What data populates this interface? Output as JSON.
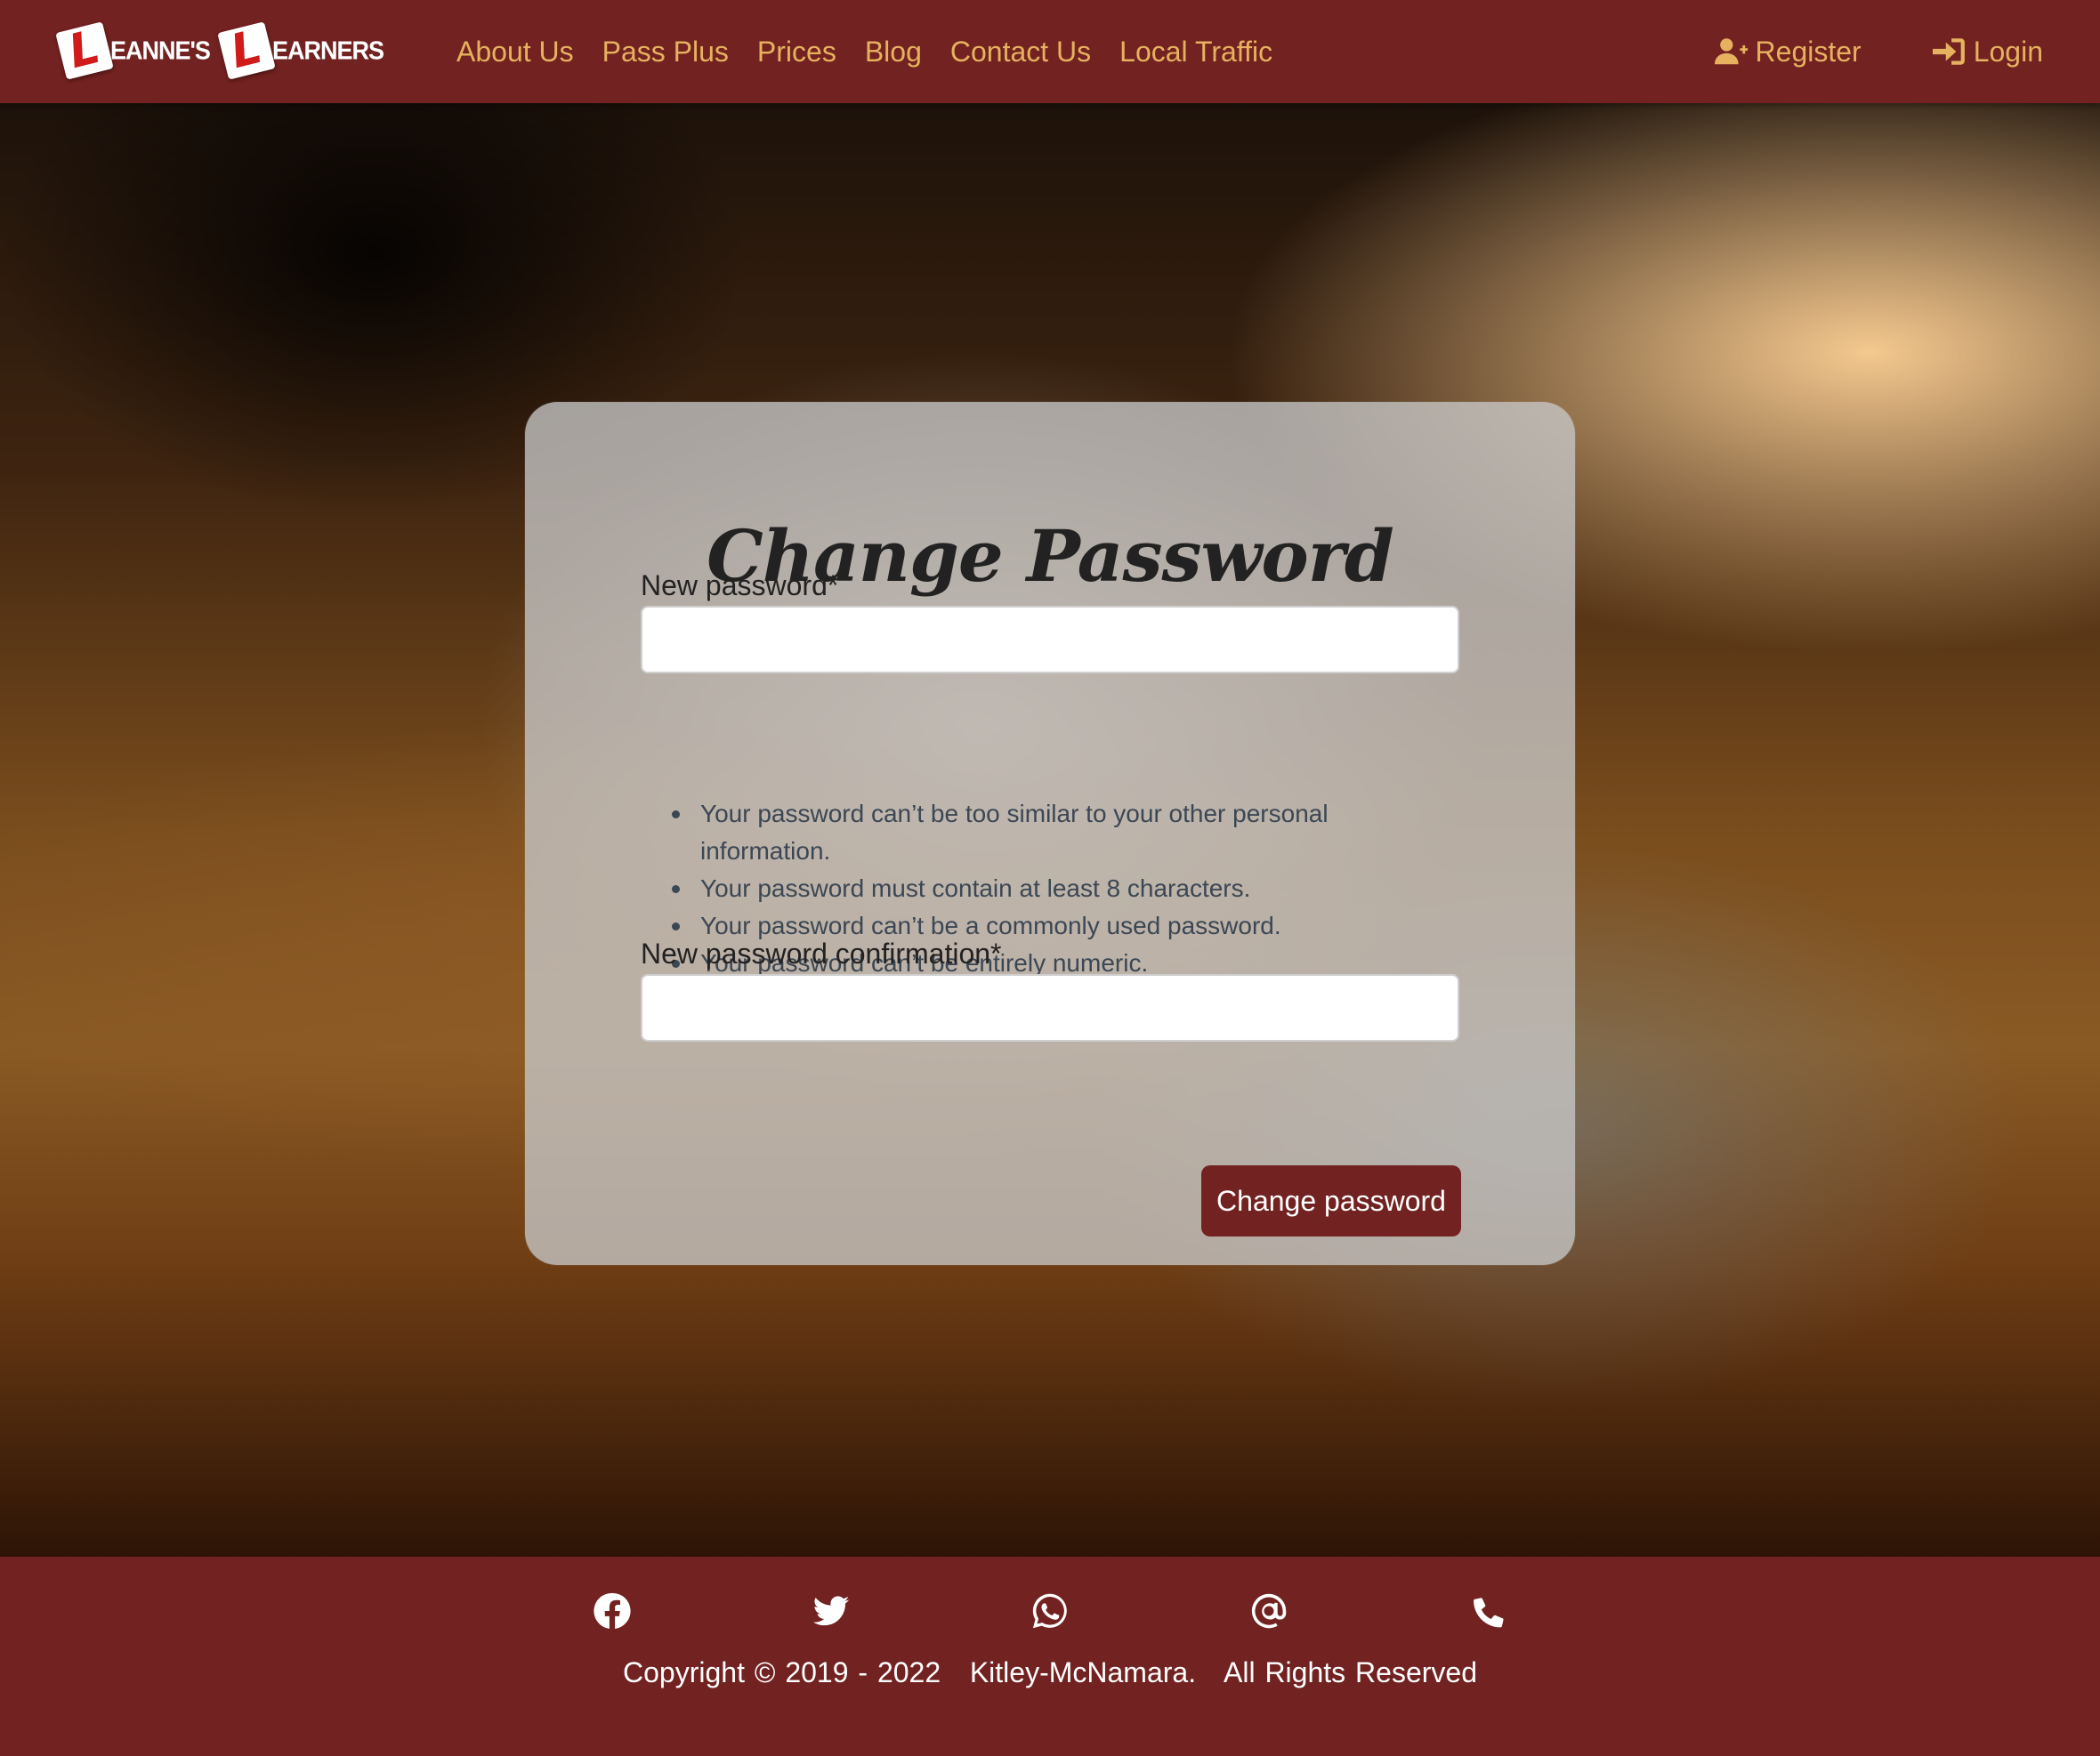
{
  "brand": {
    "first_letter": "L",
    "first_word": "EANNE'S",
    "second_letter": "L",
    "second_word": "EARNERS"
  },
  "nav": {
    "links": [
      "About Us",
      "Pass Plus",
      "Prices",
      "Blog",
      "Contact Us",
      "Local Traffic"
    ],
    "register_label": "Register",
    "login_label": "Login",
    "link_color": "#e6b25f",
    "bar_color": "#722220"
  },
  "form": {
    "title": "Change Password",
    "new_password_label": "New password*",
    "new_password_value": "",
    "help_items": [
      "Your password can’t be too similar to your other personal information.",
      "Your password must contain at least 8 characters.",
      "Your password can’t be a commonly used password.",
      "Your password can’t be entirely numeric."
    ],
    "confirm_label": "New password confirmation*",
    "confirm_value": "",
    "submit_label": "Change password"
  },
  "footer": {
    "social_icons": [
      "facebook-icon",
      "twitter-icon",
      "whatsapp-icon",
      "at-sign-icon",
      "phone-icon"
    ],
    "copyright": "Copyright © 2019 - 2022   Kitley-McNamara.   All Rights Reserved"
  }
}
